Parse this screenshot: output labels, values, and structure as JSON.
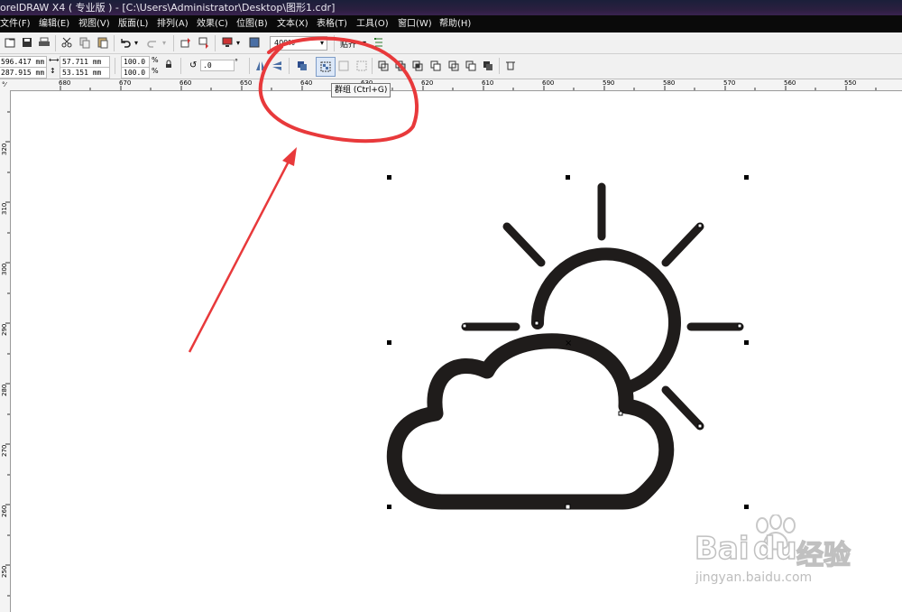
{
  "window": {
    "title": "orelDRAW X4 ( 专业版 ) - [C:\\Users\\Administrator\\Desktop\\图形1.cdr]"
  },
  "menu": [
    "文件(F)",
    "编辑(E)",
    "视图(V)",
    "版面(L)",
    "排列(A)",
    "效果(C)",
    "位图(B)",
    "文本(X)",
    "表格(T)",
    "工具(O)",
    "窗口(W)",
    "帮助(H)"
  ],
  "toolbar": {
    "zoom": "400%",
    "snap_label": "贴齐"
  },
  "property_bar": {
    "x": "596.417 mm",
    "y": "287.915 mm",
    "width": "57.711 mm",
    "height": "53.151 mm",
    "scale_x": "100.0",
    "scale_y": "100.0",
    "percent": "%",
    "angle": ".0",
    "degree": "°"
  },
  "tooltip": "群组 (Ctrl+G)",
  "ruler": {
    "h_labels": [
      "680",
      "670",
      "660",
      "650",
      "640",
      "630",
      "620",
      "610",
      "600",
      "590",
      "580",
      "570",
      "560",
      "550"
    ],
    "v_labels": [
      "320",
      "310",
      "300",
      "290",
      "280",
      "270",
      "260",
      "250"
    ]
  },
  "watermark": {
    "brand": "Bai",
    "brand2": "du",
    "cn": "经验",
    "url": "jingyan.baidu.com"
  },
  "annotation_color": "#e8393b",
  "icon_names": [
    "cloud-sun-drawing",
    "red-circle-annotation",
    "red-arrow-annotation"
  ]
}
